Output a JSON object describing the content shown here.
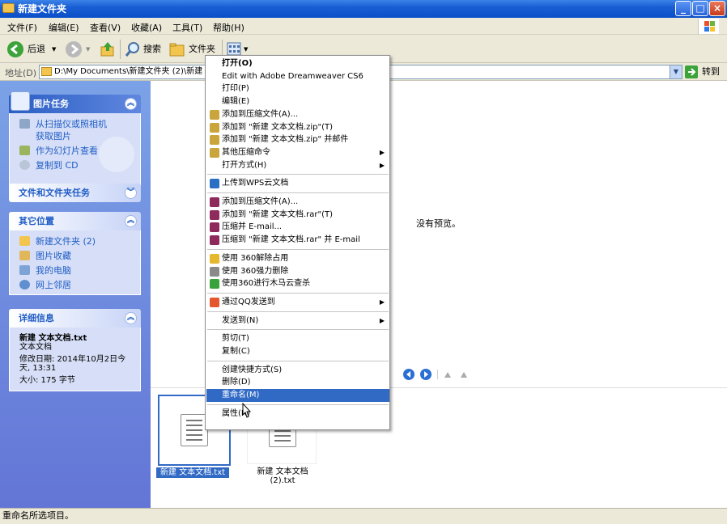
{
  "window": {
    "title": "新建文件夹",
    "buttons": [
      "_",
      "□",
      "×"
    ]
  },
  "menubar": {
    "items": [
      "文件(F)",
      "编辑(E)",
      "查看(V)",
      "收藏(A)",
      "工具(T)",
      "帮助(H)"
    ]
  },
  "toolbar": {
    "back": "后退",
    "search": "搜索",
    "folders": "文件夹"
  },
  "address": {
    "label": "地址(D)",
    "value": "D:\\My Documents\\新建文件夹 (2)\\新建",
    "go": "转到"
  },
  "left_pane": {
    "picture_tasks": {
      "title": "图片任务",
      "items": [
        "从扫描仪或照相机获取图片",
        "作为幻灯片查看",
        "复制到 CD"
      ]
    },
    "file_tasks": {
      "title": "文件和文件夹任务"
    },
    "other_places": {
      "title": "其它位置",
      "items": [
        "新建文件夹 (2)",
        "图片收藏",
        "我的电脑",
        "网上邻居"
      ]
    },
    "details": {
      "title": "详细信息",
      "name": "新建 文本文档.txt",
      "type": "文本文档",
      "modified": "修改日期: 2014年10月2日今天, 13:31",
      "size": "大小: 175 字节"
    }
  },
  "preview": {
    "no_preview": "没有预览。"
  },
  "files": [
    {
      "name": "新建 文本文档.txt",
      "selected": true
    },
    {
      "name": "新建 文本文档 (2).txt",
      "selected": false
    }
  ],
  "context_menu": {
    "items": [
      {
        "label": "打开(O)",
        "bold": true
      },
      {
        "label": "Edit with Adobe Dreamweaver CS6"
      },
      {
        "label": "打印(P)"
      },
      {
        "label": "编辑(E)"
      },
      {
        "label": "添加到压缩文件(A)...",
        "icon": "winzip-icon"
      },
      {
        "label": "添加到 \"新建 文本文档.zip\"(T)",
        "icon": "winzip-icon"
      },
      {
        "label": "添加到 \"新建 文本文档.zip\" 并邮件",
        "icon": "winzip-icon"
      },
      {
        "label": "其他压缩命令",
        "icon": "winzip-icon",
        "submenu": true
      },
      {
        "label": "打开方式(H)",
        "submenu": true
      },
      {
        "label": "上传到WPS云文档",
        "icon": "wps-icon",
        "sep_before": true
      },
      {
        "label": "添加到压缩文件(A)...",
        "icon": "winrar-icon",
        "sep_before": true
      },
      {
        "label": "添加到 \"新建 文本文档.rar\"(T)",
        "icon": "winrar-icon"
      },
      {
        "label": "压缩并 E-mail...",
        "icon": "winrar-icon"
      },
      {
        "label": "压缩到 \"新建 文本文档.rar\" 并 E-mail",
        "icon": "winrar-icon"
      },
      {
        "label": "使用 360解除占用",
        "icon": "360-unlock-icon",
        "sep_before": true
      },
      {
        "label": "使用 360强力删除",
        "icon": "360-delete-icon"
      },
      {
        "label": "使用360进行木马云查杀",
        "icon": "360-scan-icon"
      },
      {
        "label": "通过QQ发送到",
        "icon": "qq-icon",
        "submenu": true,
        "sep_before": true
      },
      {
        "label": "发送到(N)",
        "submenu": true,
        "sep_before": true
      },
      {
        "label": "剪切(T)",
        "sep_before": true
      },
      {
        "label": "复制(C)"
      },
      {
        "label": "创建快捷方式(S)",
        "sep_before": true
      },
      {
        "label": "删除(D)"
      },
      {
        "label": "重命名(M)",
        "highlighted": true
      },
      {
        "label": "属性(R)",
        "sep_before": true
      }
    ]
  },
  "status": {
    "text": "重命名所选项目。"
  },
  "colors": {
    "titlebar": "#0a4fc8",
    "highlight": "#316ac5",
    "left_pane": "#6375d6",
    "chrome": "#ece9d8"
  }
}
